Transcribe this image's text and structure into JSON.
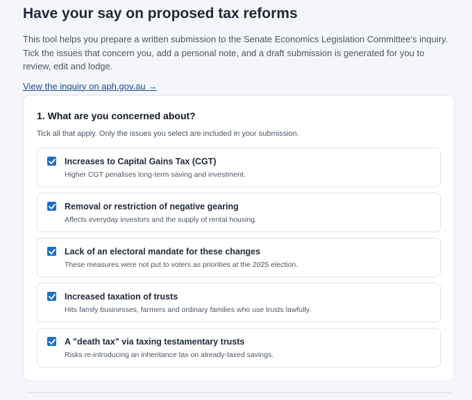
{
  "header": {
    "title": "Have your say on proposed tax reforms",
    "intro": "This tool helps you prepare a written submission to the Senate Economics Legislation Committee's inquiry. Tick the issues that concern you, add a personal note, and a draft submission is generated for you to review, edit and lodge.",
    "link_label": "View the inquiry on aph.gov.au →"
  },
  "section1": {
    "title": "1. What are you concerned about?",
    "hint": "Tick all that apply. Only the issues you select are included in your submission.",
    "options": [
      {
        "title": "Increases to Capital Gains Tax (CGT)",
        "desc": "Higher CGT penalises long-term saving and investment.",
        "checked": true
      },
      {
        "title": "Removal or restriction of negative gearing",
        "desc": "Affects everyday investors and the supply of rental housing.",
        "checked": true
      },
      {
        "title": "Lack of an electoral mandate for these changes",
        "desc": "These measures were not put to voters as priorities at the 2025 election.",
        "checked": true
      },
      {
        "title": "Increased taxation of trusts",
        "desc": "Hits family businesses, farmers and ordinary families who use trusts lawfully.",
        "checked": true
      },
      {
        "title": "A \"death tax\" via taxing testamentary trusts",
        "desc": "Risks re-introducing an inheritance tax on already-taxed savings.",
        "checked": true
      }
    ]
  },
  "colors": {
    "accent": "#1f6fc5",
    "link": "#1e4e8c"
  }
}
